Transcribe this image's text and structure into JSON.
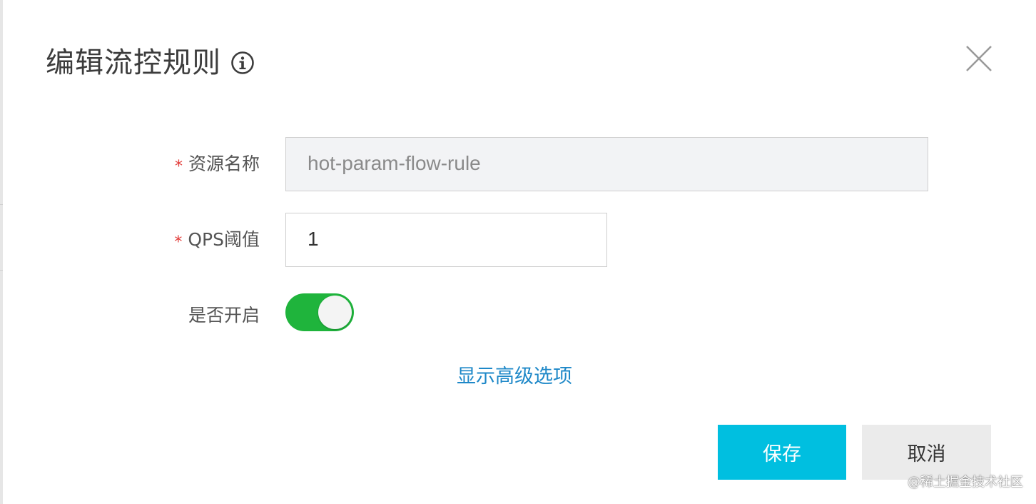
{
  "dialog": {
    "title": "编辑流控规则",
    "info_icon": "info-circle-icon",
    "close_icon": "close-icon"
  },
  "form": {
    "resource_name": {
      "label": "资源名称",
      "required_mark": "*",
      "value": "hot-param-flow-rule",
      "disabled": true
    },
    "qps_threshold": {
      "label": "QPS阈值",
      "required_mark": "*",
      "value": "1"
    },
    "enabled": {
      "label": "是否开启",
      "on": true
    },
    "advanced_link": "显示高级选项"
  },
  "buttons": {
    "save_label": "保存",
    "cancel_label": "取消"
  },
  "watermark": "@稀土掘金技术社区",
  "colors": {
    "required": "#e23c39",
    "link": "#1e88c8",
    "toggle_on": "#1fb43c",
    "save_button": "#00bfe0",
    "cancel_button": "#ebebeb",
    "disabled_input_bg": "#f2f3f5"
  }
}
